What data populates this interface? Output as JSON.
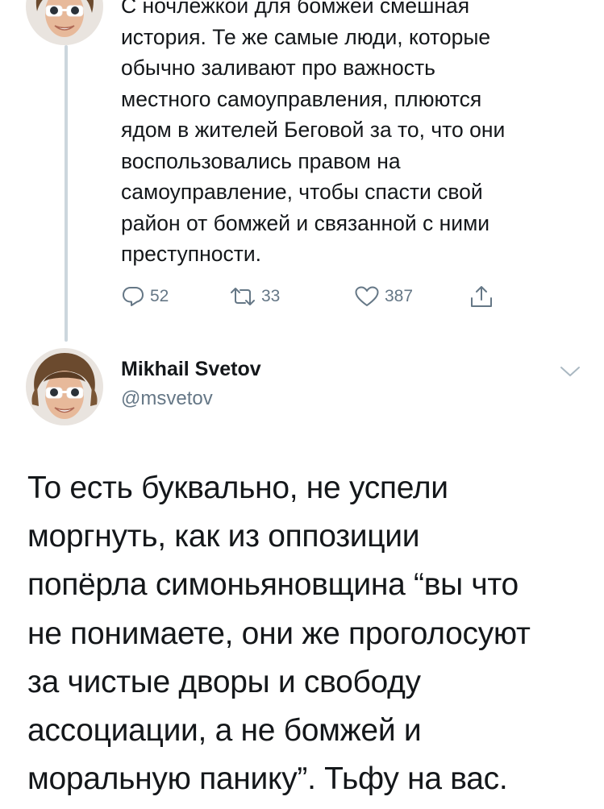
{
  "previous_tweet": {
    "avatar_alt": "Mikhail Svetov avatar",
    "text_lines": [
      "С ночлежкой для бомжей смешная",
      "история. Те же самые люди, которые",
      "обычно заливают про важность",
      "местного самоуправления, плюются",
      "ядом в жителей Беговой за то, что они",
      "воспользовались правом на",
      "самоуправление, чтобы спасти свой",
      "район от бомжей и связанной с ними",
      "преступности."
    ],
    "actions": {
      "reply_count": "52",
      "retweet_count": "33",
      "like_count": "387"
    }
  },
  "tweet": {
    "author_name": "Mikhail Svetov",
    "author_handle": "@msvetov",
    "text_lines": [
      "То есть буквально, не успели",
      "моргнуть, как из оппозиции",
      "попёрла симоньяновщина “вы что",
      "не понимаете, они же проголосуют",
      "за чистые дворы и свободу",
      "ассоциации, а не бомжей и",
      "моральную панику”. Тьфу на вас."
    ]
  },
  "icons": {
    "reply": "reply-icon",
    "retweet": "retweet-icon",
    "like": "heart-icon",
    "share": "share-icon",
    "menu": "chevron-down-icon"
  },
  "colors": {
    "text": "#14171a",
    "secondary": "#657786",
    "thread_line": "#ccd6dd"
  }
}
